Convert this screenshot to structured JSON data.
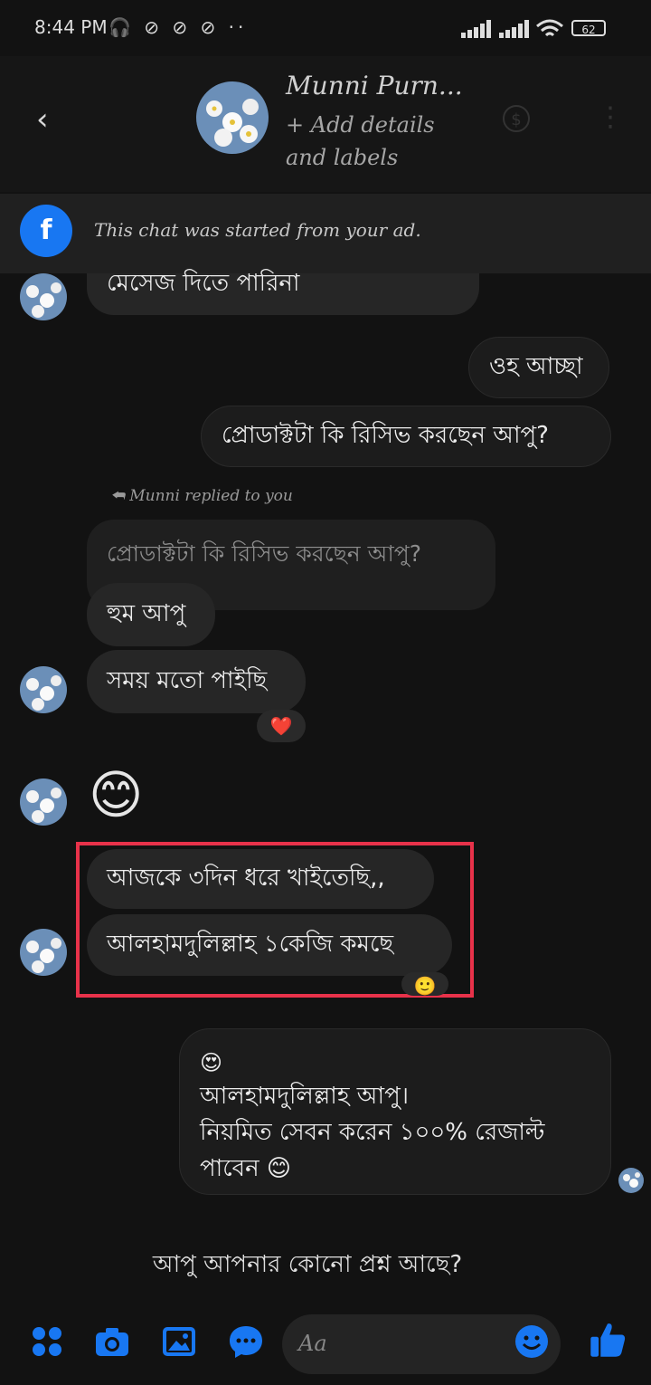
{
  "status_bar": {
    "time": "8:44 PM",
    "battery": "62"
  },
  "header": {
    "name": "Munni Purn...",
    "subtitle": "+ Add details and labels"
  },
  "ad_banner": {
    "text": "This chat was started from your ad."
  },
  "messages": {
    "m1": "মেসেজ দিতে পারিনা",
    "m2": "ওহ আচ্ছা",
    "m3": "প্রোডাক্টটা কি রিসিভ করছেন আপু?",
    "replied_label": "Munni replied to you",
    "quoted": "প্রোডাক্টটা কি রিসিভ করছেন আপু?",
    "m4": "হুম আপু",
    "m5": "সময় মতো পাইছি",
    "m6_emoji": "😊",
    "m7": "আজকে ৩দিন ধরে খাইতেছি,,",
    "m8": "আলহামদুলিল্লাহ ১কেজি কমছে",
    "m9_emoji": "😍",
    "m9_line1": "আলহামদুলিল্লাহ আপু।",
    "m9_line2": "নিয়মিত সেবন করেন ১০০% রেজাল্ট",
    "m9_line3": "পাবেন 😊",
    "suggested": "আপু আপনার কোনো প্রশ্ন আছে?"
  },
  "reactions": {
    "heart": "❤️",
    "smile": "🙂"
  },
  "composer": {
    "placeholder": "Aa"
  },
  "colors": {
    "accent": "#1877f2",
    "highlight": "#e8324a"
  }
}
